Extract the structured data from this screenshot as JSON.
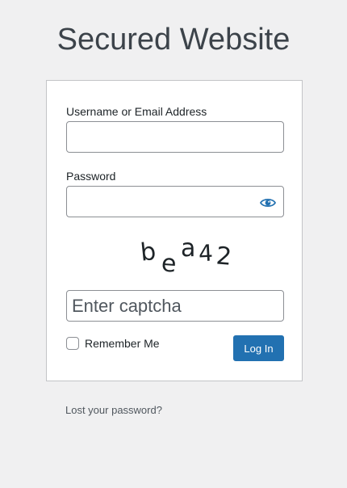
{
  "site": {
    "title": "Secured Website"
  },
  "login_form": {
    "username_label": "Username or Email Address",
    "username_value": "",
    "password_label": "Password",
    "password_value": "",
    "password_toggle_icon": "eye-icon",
    "captcha_text": [
      "b",
      "e",
      "a",
      "4",
      "2"
    ],
    "captcha_placeholder": "Enter captcha",
    "remember_label": "Remember Me",
    "remember_checked": false,
    "submit_label": "Log In"
  },
  "links": {
    "lost_password": "Lost your password?"
  },
  "colors": {
    "background": "#f0f0f1",
    "primary_button": "#2271b1",
    "eye_icon": "#2271b1"
  }
}
